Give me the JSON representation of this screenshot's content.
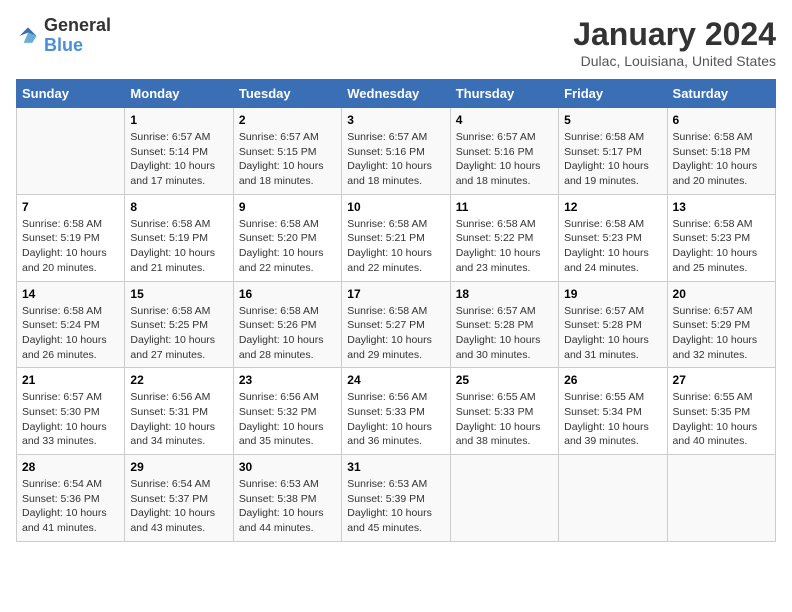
{
  "logo": {
    "general": "General",
    "blue": "Blue"
  },
  "title": "January 2024",
  "location": "Dulac, Louisiana, United States",
  "days_of_week": [
    "Sunday",
    "Monday",
    "Tuesday",
    "Wednesday",
    "Thursday",
    "Friday",
    "Saturday"
  ],
  "weeks": [
    [
      {
        "num": "",
        "sunrise": "",
        "sunset": "",
        "daylight": ""
      },
      {
        "num": "1",
        "sunrise": "Sunrise: 6:57 AM",
        "sunset": "Sunset: 5:14 PM",
        "daylight": "Daylight: 10 hours and 17 minutes."
      },
      {
        "num": "2",
        "sunrise": "Sunrise: 6:57 AM",
        "sunset": "Sunset: 5:15 PM",
        "daylight": "Daylight: 10 hours and 18 minutes."
      },
      {
        "num": "3",
        "sunrise": "Sunrise: 6:57 AM",
        "sunset": "Sunset: 5:16 PM",
        "daylight": "Daylight: 10 hours and 18 minutes."
      },
      {
        "num": "4",
        "sunrise": "Sunrise: 6:57 AM",
        "sunset": "Sunset: 5:16 PM",
        "daylight": "Daylight: 10 hours and 18 minutes."
      },
      {
        "num": "5",
        "sunrise": "Sunrise: 6:58 AM",
        "sunset": "Sunset: 5:17 PM",
        "daylight": "Daylight: 10 hours and 19 minutes."
      },
      {
        "num": "6",
        "sunrise": "Sunrise: 6:58 AM",
        "sunset": "Sunset: 5:18 PM",
        "daylight": "Daylight: 10 hours and 20 minutes."
      }
    ],
    [
      {
        "num": "7",
        "sunrise": "Sunrise: 6:58 AM",
        "sunset": "Sunset: 5:19 PM",
        "daylight": "Daylight: 10 hours and 20 minutes."
      },
      {
        "num": "8",
        "sunrise": "Sunrise: 6:58 AM",
        "sunset": "Sunset: 5:19 PM",
        "daylight": "Daylight: 10 hours and 21 minutes."
      },
      {
        "num": "9",
        "sunrise": "Sunrise: 6:58 AM",
        "sunset": "Sunset: 5:20 PM",
        "daylight": "Daylight: 10 hours and 22 minutes."
      },
      {
        "num": "10",
        "sunrise": "Sunrise: 6:58 AM",
        "sunset": "Sunset: 5:21 PM",
        "daylight": "Daylight: 10 hours and 22 minutes."
      },
      {
        "num": "11",
        "sunrise": "Sunrise: 6:58 AM",
        "sunset": "Sunset: 5:22 PM",
        "daylight": "Daylight: 10 hours and 23 minutes."
      },
      {
        "num": "12",
        "sunrise": "Sunrise: 6:58 AM",
        "sunset": "Sunset: 5:23 PM",
        "daylight": "Daylight: 10 hours and 24 minutes."
      },
      {
        "num": "13",
        "sunrise": "Sunrise: 6:58 AM",
        "sunset": "Sunset: 5:23 PM",
        "daylight": "Daylight: 10 hours and 25 minutes."
      }
    ],
    [
      {
        "num": "14",
        "sunrise": "Sunrise: 6:58 AM",
        "sunset": "Sunset: 5:24 PM",
        "daylight": "Daylight: 10 hours and 26 minutes."
      },
      {
        "num": "15",
        "sunrise": "Sunrise: 6:58 AM",
        "sunset": "Sunset: 5:25 PM",
        "daylight": "Daylight: 10 hours and 27 minutes."
      },
      {
        "num": "16",
        "sunrise": "Sunrise: 6:58 AM",
        "sunset": "Sunset: 5:26 PM",
        "daylight": "Daylight: 10 hours and 28 minutes."
      },
      {
        "num": "17",
        "sunrise": "Sunrise: 6:58 AM",
        "sunset": "Sunset: 5:27 PM",
        "daylight": "Daylight: 10 hours and 29 minutes."
      },
      {
        "num": "18",
        "sunrise": "Sunrise: 6:57 AM",
        "sunset": "Sunset: 5:28 PM",
        "daylight": "Daylight: 10 hours and 30 minutes."
      },
      {
        "num": "19",
        "sunrise": "Sunrise: 6:57 AM",
        "sunset": "Sunset: 5:28 PM",
        "daylight": "Daylight: 10 hours and 31 minutes."
      },
      {
        "num": "20",
        "sunrise": "Sunrise: 6:57 AM",
        "sunset": "Sunset: 5:29 PM",
        "daylight": "Daylight: 10 hours and 32 minutes."
      }
    ],
    [
      {
        "num": "21",
        "sunrise": "Sunrise: 6:57 AM",
        "sunset": "Sunset: 5:30 PM",
        "daylight": "Daylight: 10 hours and 33 minutes."
      },
      {
        "num": "22",
        "sunrise": "Sunrise: 6:56 AM",
        "sunset": "Sunset: 5:31 PM",
        "daylight": "Daylight: 10 hours and 34 minutes."
      },
      {
        "num": "23",
        "sunrise": "Sunrise: 6:56 AM",
        "sunset": "Sunset: 5:32 PM",
        "daylight": "Daylight: 10 hours and 35 minutes."
      },
      {
        "num": "24",
        "sunrise": "Sunrise: 6:56 AM",
        "sunset": "Sunset: 5:33 PM",
        "daylight": "Daylight: 10 hours and 36 minutes."
      },
      {
        "num": "25",
        "sunrise": "Sunrise: 6:55 AM",
        "sunset": "Sunset: 5:33 PM",
        "daylight": "Daylight: 10 hours and 38 minutes."
      },
      {
        "num": "26",
        "sunrise": "Sunrise: 6:55 AM",
        "sunset": "Sunset: 5:34 PM",
        "daylight": "Daylight: 10 hours and 39 minutes."
      },
      {
        "num": "27",
        "sunrise": "Sunrise: 6:55 AM",
        "sunset": "Sunset: 5:35 PM",
        "daylight": "Daylight: 10 hours and 40 minutes."
      }
    ],
    [
      {
        "num": "28",
        "sunrise": "Sunrise: 6:54 AM",
        "sunset": "Sunset: 5:36 PM",
        "daylight": "Daylight: 10 hours and 41 minutes."
      },
      {
        "num": "29",
        "sunrise": "Sunrise: 6:54 AM",
        "sunset": "Sunset: 5:37 PM",
        "daylight": "Daylight: 10 hours and 43 minutes."
      },
      {
        "num": "30",
        "sunrise": "Sunrise: 6:53 AM",
        "sunset": "Sunset: 5:38 PM",
        "daylight": "Daylight: 10 hours and 44 minutes."
      },
      {
        "num": "31",
        "sunrise": "Sunrise: 6:53 AM",
        "sunset": "Sunset: 5:39 PM",
        "daylight": "Daylight: 10 hours and 45 minutes."
      },
      {
        "num": "",
        "sunrise": "",
        "sunset": "",
        "daylight": ""
      },
      {
        "num": "",
        "sunrise": "",
        "sunset": "",
        "daylight": ""
      },
      {
        "num": "",
        "sunrise": "",
        "sunset": "",
        "daylight": ""
      }
    ]
  ]
}
